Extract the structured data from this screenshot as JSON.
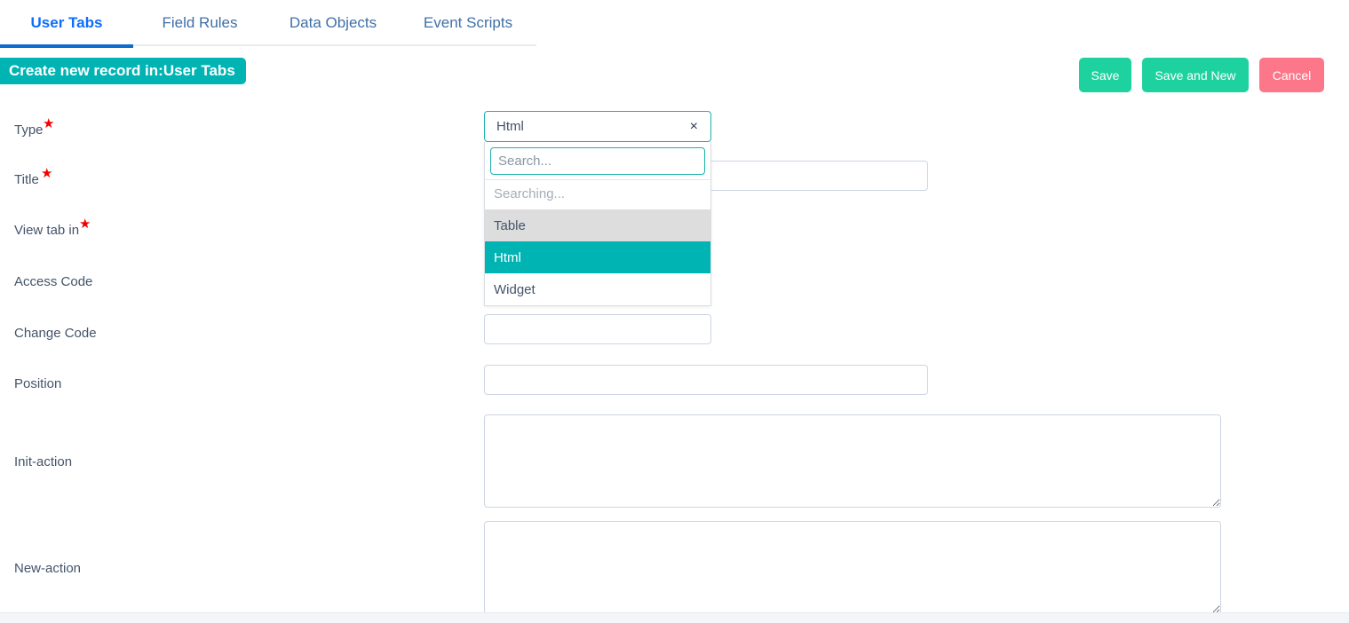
{
  "tabs": [
    {
      "label": "User Tabs",
      "active": true
    },
    {
      "label": "Field Rules",
      "active": false
    },
    {
      "label": "Data Objects",
      "active": false
    },
    {
      "label": "Event Scripts",
      "active": false
    }
  ],
  "header": {
    "record_title": "Create new record in:User Tabs",
    "save_label": "Save",
    "save_and_new_label": "Save and New",
    "cancel_label": "Cancel"
  },
  "colors": {
    "teal": "#00b4b4",
    "green": "#1ed2a0",
    "red": "#fc7789",
    "tab_blue": "#0d6efd",
    "label": "#44546a",
    "required_star": "#f00000"
  },
  "form": {
    "fields": [
      {
        "label": "Type",
        "required": true,
        "value": ""
      },
      {
        "label": "Title",
        "required": true,
        "value": ""
      },
      {
        "label": "View tab in",
        "required": true,
        "value": ""
      },
      {
        "label": "Access Code",
        "required": false,
        "value": ""
      },
      {
        "label": "Change Code",
        "required": false,
        "value": ""
      },
      {
        "label": "Position",
        "required": false,
        "value": ""
      },
      {
        "label": "Init-action",
        "required": false,
        "value": ""
      },
      {
        "label": "New-action",
        "required": false,
        "value": ""
      }
    ],
    "required_marker": "★"
  },
  "type_select": {
    "selected_value": "Html",
    "clear_icon": "×",
    "search_placeholder": "Search...",
    "status_text": "Searching...",
    "options": [
      {
        "label": "Table",
        "state": "hover"
      },
      {
        "label": "Html",
        "state": "selected"
      },
      {
        "label": "Widget",
        "state": "normal"
      }
    ]
  }
}
